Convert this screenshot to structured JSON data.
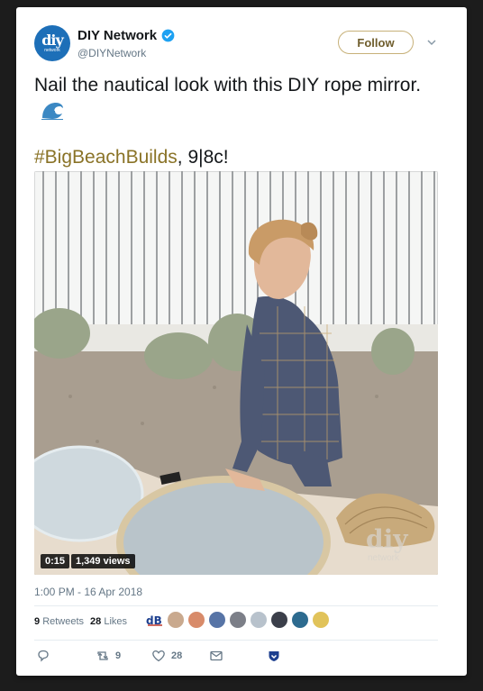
{
  "account": {
    "name": "DIY Network",
    "handle": "@DIYNetwork",
    "avatar_logo_main": "diy",
    "avatar_logo_sub": "network"
  },
  "follow_label": "Follow",
  "tweet": {
    "text_line": "Nail the nautical look with this DIY rope mirror.",
    "hashtag": "#BigBeachBuilds",
    "after_hashtag": ", 9|8c!",
    "emoji_icon": "water-wave-icon"
  },
  "video": {
    "duration": "0:15",
    "views": "1,349 views",
    "watermark_main": "diy",
    "watermark_sub": "network"
  },
  "timestamp": "1:00 PM - 16 Apr 2018",
  "stats": {
    "retweets_count": "9",
    "retweets_label": "Retweets",
    "likes_count": "28",
    "likes_label": "Likes"
  },
  "actions": {
    "reply_count": "",
    "retweet_count": "9",
    "like_count": "28"
  },
  "colors": {
    "accent_gold": "#8a7327",
    "follow_border": "#c7b179",
    "brand_blue": "#1d6fb8",
    "verified_blue": "#1da1f2",
    "secondary_text": "#657786"
  }
}
